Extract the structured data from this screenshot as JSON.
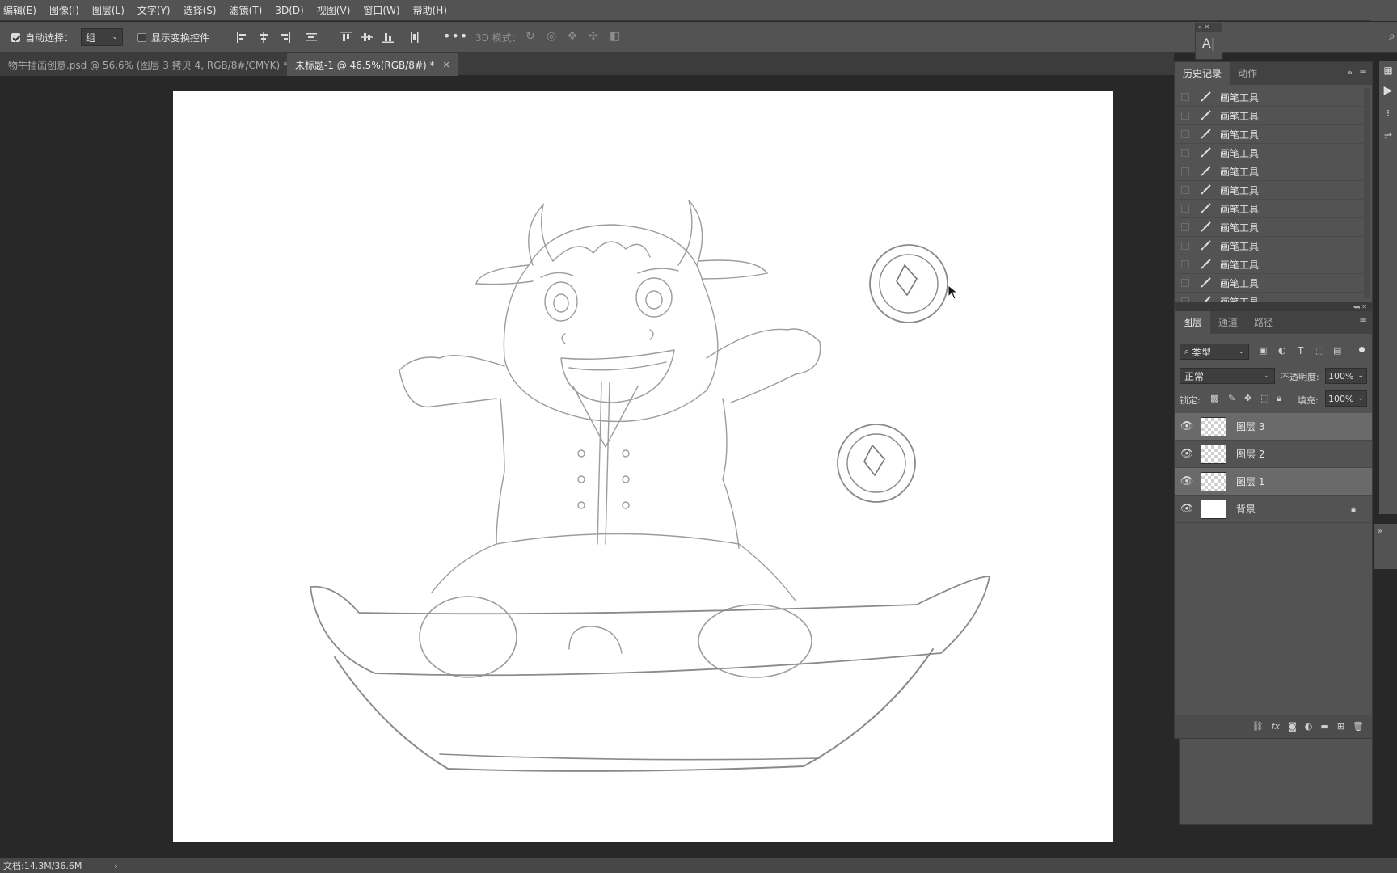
{
  "menu": [
    "编辑(E)",
    "图像(I)",
    "图层(L)",
    "文字(Y)",
    "选择(S)",
    "滤镜(T)",
    "3D(D)",
    "视图(V)",
    "窗口(W)",
    "帮助(H)"
  ],
  "options": {
    "auto_select_label": "自动选择：",
    "auto_select_value": "组",
    "show_transform_label": "显示变换控件",
    "mode_3d_label": "3D 模式："
  },
  "tabs": [
    {
      "label": "物牛插画创意.psd @ 56.6% (图层 3 拷贝 4, RGB/8#/CMYK) *"
    },
    {
      "label": "未标题-1 @ 46.5%(RGB/8#) *"
    }
  ],
  "history_panel": {
    "tabs": [
      "历史记录",
      "动作"
    ],
    "items": [
      "画笔工具",
      "画笔工具",
      "画笔工具",
      "画笔工具",
      "画笔工具",
      "画笔工具",
      "画笔工具",
      "画笔工具",
      "画笔工具",
      "画笔工具",
      "画笔工具",
      "画笔工具"
    ]
  },
  "layers_panel": {
    "tabs": [
      "图层",
      "通道",
      "路径"
    ],
    "filter_label": "类型",
    "blend_mode": "正常",
    "opacity_label": "不透明度:",
    "opacity_value": "100%",
    "lock_label": "锁定:",
    "fill_label": "填充:",
    "fill_value": "100%",
    "layers": [
      {
        "name": "图层 3",
        "selected": true,
        "thumb": "transparent"
      },
      {
        "name": "图层 2",
        "selected": false,
        "thumb": "transparent"
      },
      {
        "name": "图层 1",
        "selected": true,
        "thumb": "transparent"
      },
      {
        "name": "背景",
        "selected": false,
        "thumb": "white",
        "locked": true
      }
    ]
  },
  "status": {
    "doc_info": "文档:14.3M/36.6M",
    "arrow": "›"
  },
  "char_panel_icon": "A|"
}
